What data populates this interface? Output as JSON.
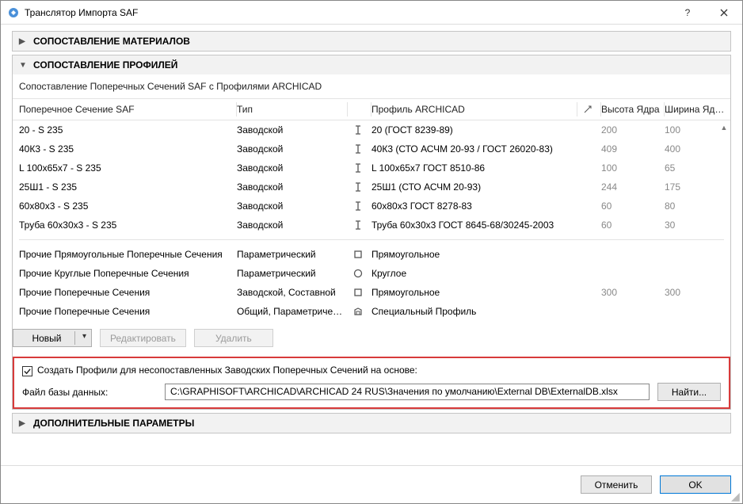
{
  "window": {
    "title": "Транслятор Импорта SAF"
  },
  "panels": {
    "materials": {
      "title": "СОПОСТАВЛЕНИЕ МАТЕРИАЛОВ"
    },
    "profiles": {
      "title": "СОПОСТАВЛЕНИЕ ПРОФИЛЕЙ"
    },
    "extra": {
      "title": "ДОПОЛНИТЕЛЬНЫЕ ПАРАМЕТРЫ"
    }
  },
  "profiles": {
    "description": "Сопоставление Поперечных Сечений SAF с Профилями ARCHICAD",
    "columns": {
      "saf": "Поперечное Сечение SAF",
      "type": "Тип",
      "profile": "Профиль ARCHICAD",
      "height": "Высота Ядра",
      "width": "Ширина Ядра"
    },
    "rows": [
      {
        "saf": "20 - S 235",
        "type": "Заводской",
        "profile": "20 (ГОСТ 8239-89)",
        "height": "200",
        "width": "100"
      },
      {
        "saf": "40К3 - S 235",
        "type": "Заводской",
        "profile": "40К3 (СТО АСЧМ 20-93 / ГОСТ 26020-83)",
        "height": "409",
        "width": "400"
      },
      {
        "saf": "L 100x65x7 - S 235",
        "type": "Заводской",
        "profile": "L 100x65x7 ГОСТ 8510-86",
        "height": "100",
        "width": "65"
      },
      {
        "saf": "25Ш1 - S 235",
        "type": "Заводской",
        "profile": "25Ш1 (СТО АСЧМ 20-93)",
        "height": "244",
        "width": "175"
      },
      {
        "saf": "60x80x3 - S 235",
        "type": "Заводской",
        "profile": "60x80x3 ГОСТ 8278-83",
        "height": "60",
        "width": "80"
      },
      {
        "saf": "Труба 60x30x3 - S 235",
        "type": "Заводской",
        "profile": "Труба 60x30x3 ГОСТ 8645-68/30245-2003",
        "height": "60",
        "width": "30"
      }
    ],
    "generic": [
      {
        "saf": "Прочие Прямоугольные Поперечные Сечения",
        "type": "Параметрический",
        "shape": "rect",
        "profile": "Прямоугольное",
        "height": "",
        "width": ""
      },
      {
        "saf": "Прочие Круглые Поперечные Сечения",
        "type": "Параметрический",
        "shape": "circle",
        "profile": "Круглое",
        "height": "",
        "width": ""
      },
      {
        "saf": "Прочие Поперечные Сечения",
        "type": "Заводской, Составной",
        "shape": "rect",
        "profile": "Прямоугольное",
        "height": "300",
        "width": "300"
      },
      {
        "saf": "Прочие Поперечные Сечения",
        "type": "Общий, Параметрический",
        "shape": "custom",
        "profile": "Специальный Профиль",
        "height": "",
        "width": ""
      }
    ],
    "buttons": {
      "new": "Новый",
      "edit": "Редактировать",
      "delete": "Удалить"
    }
  },
  "create": {
    "label": "Создать Профили для несопоставленных Заводских Поперечных Сечений на основе:",
    "checked": true,
    "db_label": "Файл базы данных:",
    "db_path": "C:\\GRAPHISOFT\\ARCHICAD\\ARCHICAD 24 RUS\\Значения по умолчанию\\External DB\\ExternalDB.xlsx",
    "browse": "Найти..."
  },
  "footer": {
    "cancel": "Отменить",
    "ok": "OK"
  }
}
